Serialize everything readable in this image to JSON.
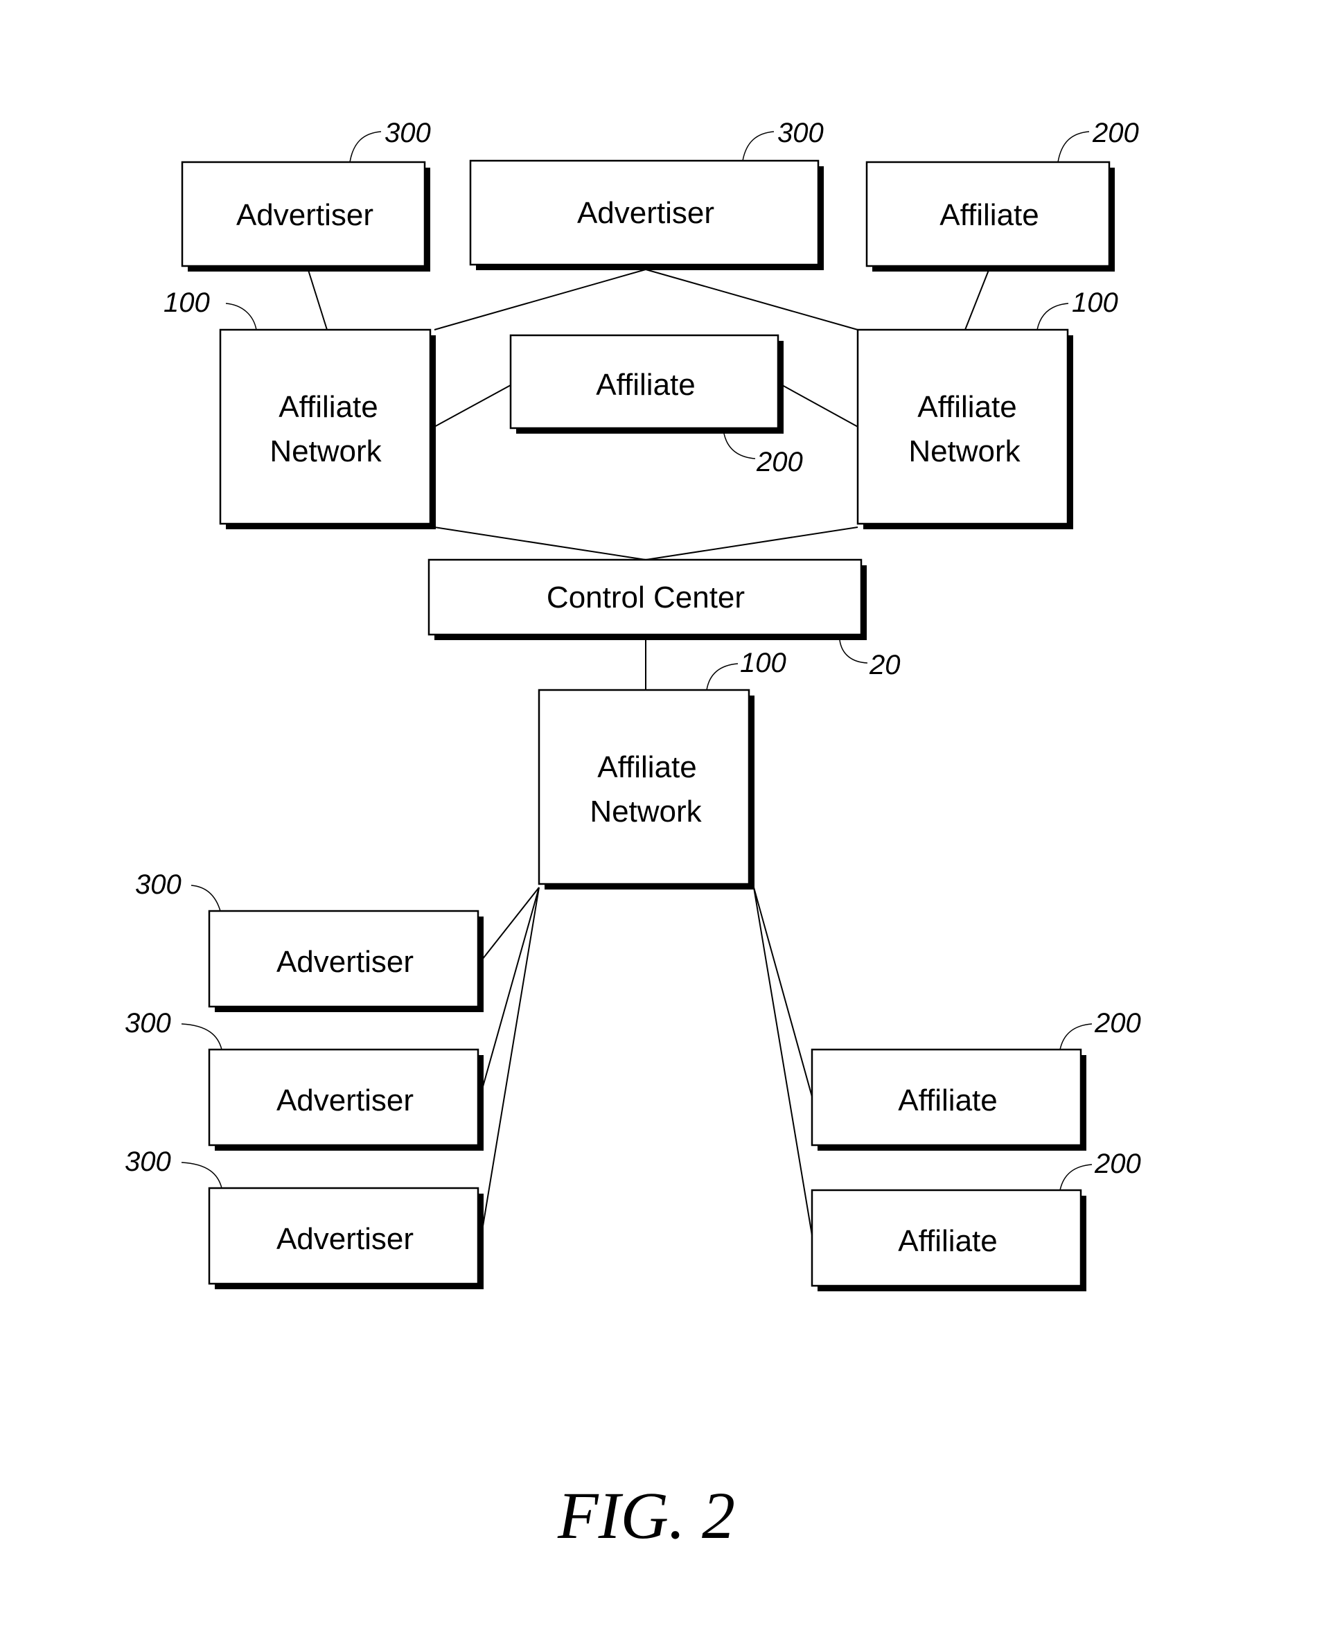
{
  "figure_label": "FIG. 2",
  "nodes": {
    "adv_top_left": {
      "label": "Advertiser",
      "ref": "300"
    },
    "adv_top_center": {
      "label": "Advertiser",
      "ref": "300"
    },
    "aff_top_right": {
      "label": "Affiliate",
      "ref": "200"
    },
    "net_left": {
      "label_line1": "Affiliate",
      "label_line2": "Network",
      "ref": "100"
    },
    "aff_center": {
      "label": "Affiliate",
      "ref": "200"
    },
    "net_right": {
      "label_line1": "Affiliate",
      "label_line2": "Network",
      "ref": "100"
    },
    "control_center": {
      "label": "Control Center",
      "ref": "20"
    },
    "net_bottom": {
      "label_line1": "Affiliate",
      "label_line2": "Network",
      "ref": "100"
    },
    "adv_bottom_1": {
      "label": "Advertiser",
      "ref": "300"
    },
    "adv_bottom_2": {
      "label": "Advertiser",
      "ref": "300"
    },
    "adv_bottom_3": {
      "label": "Advertiser",
      "ref": "300"
    },
    "aff_bottom_1": {
      "label": "Affiliate",
      "ref": "200"
    },
    "aff_bottom_2": {
      "label": "Affiliate",
      "ref": "200"
    }
  },
  "connections": [
    [
      "adv_top_left",
      "net_left"
    ],
    [
      "adv_top_center",
      "net_left"
    ],
    [
      "adv_top_center",
      "net_right"
    ],
    [
      "aff_top_right",
      "net_right"
    ],
    [
      "aff_center",
      "net_left"
    ],
    [
      "aff_center",
      "net_right"
    ],
    [
      "net_left",
      "control_center"
    ],
    [
      "net_right",
      "control_center"
    ],
    [
      "control_center",
      "net_bottom"
    ],
    [
      "net_bottom",
      "adv_bottom_1"
    ],
    [
      "net_bottom",
      "adv_bottom_2"
    ],
    [
      "net_bottom",
      "adv_bottom_3"
    ],
    [
      "net_bottom",
      "aff_bottom_1"
    ],
    [
      "net_bottom",
      "aff_bottom_2"
    ]
  ]
}
